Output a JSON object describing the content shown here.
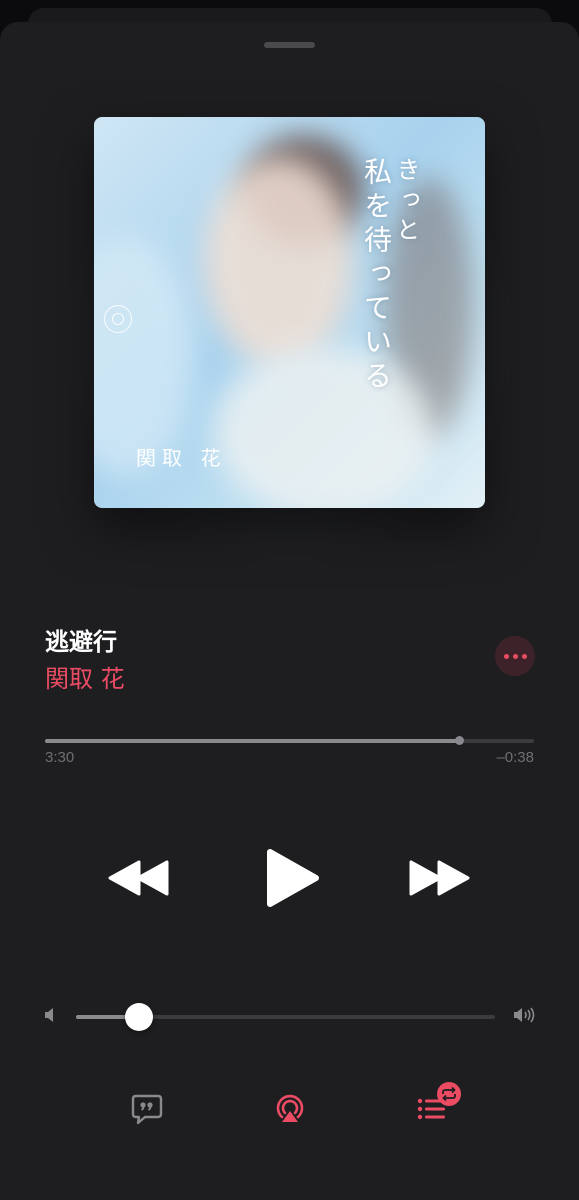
{
  "artwork": {
    "vertical_text_main": "私を待っている",
    "vertical_text_side": "きっと",
    "artist_text": "関取 花"
  },
  "track": {
    "title": "逃避行",
    "artist": "関取 花"
  },
  "playback": {
    "elapsed": "3:30",
    "remaining": "–0:38",
    "progress_fraction": 0.846
  },
  "volume": {
    "level_fraction": 0.15
  },
  "icons": {
    "more": "ellipsis-icon",
    "rewind": "rewind-icon",
    "play": "play-icon",
    "forward": "fast-forward-icon",
    "volume_low": "speaker-low-icon",
    "volume_high": "speaker-high-icon",
    "lyrics": "lyrics-quote-icon",
    "airplay": "airplay-icon",
    "queue": "queue-repeat-icon"
  },
  "colors": {
    "accent": "#ec4c63",
    "background": "#1e1e21",
    "text_primary": "#ffffff",
    "text_secondary": "#6e6e73"
  }
}
